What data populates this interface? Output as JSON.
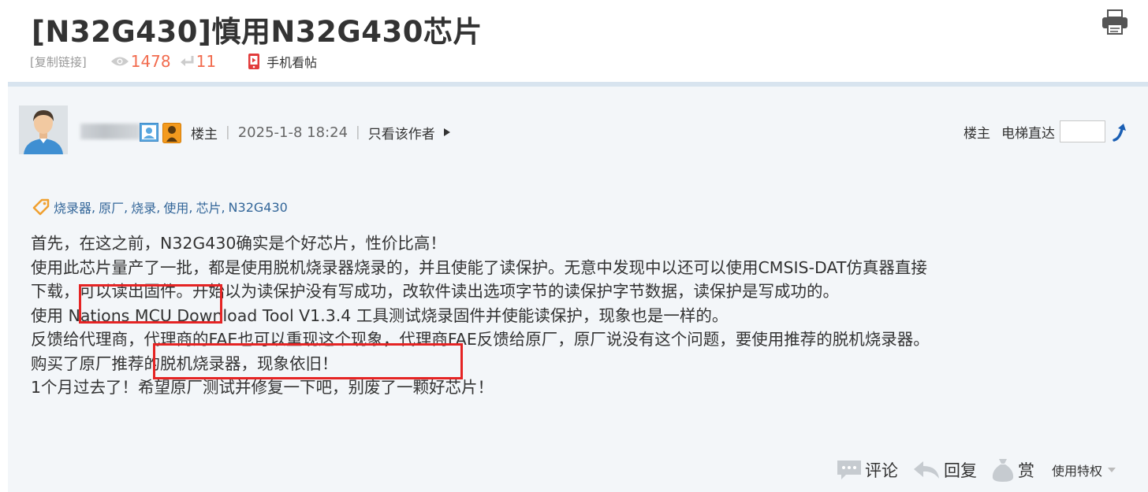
{
  "thread": {
    "title": "[N32G430]慎用N32G430芯片",
    "copy_link": "[复制链接]",
    "views": "1478",
    "replies": "11",
    "mobile_view": "手机看帖"
  },
  "post": {
    "op_label": "楼主",
    "separator": "|",
    "date": "2025-1-8 18:24",
    "only_author": "只看该作者",
    "floor_nav": {
      "op": "楼主",
      "elevator": "电梯直达"
    },
    "tags": [
      "烧录器",
      "原厂",
      "烧录",
      "使用",
      "芯片",
      "N32G430"
    ],
    "lines": [
      "首先，在这之前，N32G430确实是个好芯片，性价比高！",
      "使用此芯片量产了一批，都是使用脱机烧录器烧录的，并且使能了读保护。无意中发现中以还可以使用CMSIS-DAT仿真器直接",
      "下载，可以读出固件。开始以为读保护没有写成功，改软件读出选项字节的读保护字节数据，读保护是写成功的。",
      "使用 Nations MCU Download Tool V1.3.4 工具测试烧录固件并使能读保护，现象也是一样的。",
      "反馈给代理商，代理商的FAE也可以重现这个现象，代理商FAE反馈给原厂，原厂说没有这个问题，要使用推荐的脱机烧录器。",
      "购买了原厂推荐的脱机烧录器，现象依旧！",
      "1个月过去了！希望原厂测试并修复一下吧，别废了一颗好芯片！"
    ],
    "actions": {
      "comment": "评论",
      "reply": "回复",
      "reward": "赏",
      "privilege": "使用特权"
    }
  },
  "colors": {
    "count": "#f26c4f",
    "tag": "#336699",
    "highlight_box": "#e52424",
    "post_bg": "#f3f6f9",
    "divider": "#d8e4ef"
  },
  "icons": [
    "print-icon",
    "eye-icon",
    "reply-icon",
    "phone-icon",
    "user-badge-icon",
    "medal-badge-icon",
    "triangle-right-icon",
    "go-arrow-icon",
    "tag-icon",
    "comment-icon",
    "reply-arrow-icon",
    "money-bag-icon",
    "caret-down-icon"
  ]
}
